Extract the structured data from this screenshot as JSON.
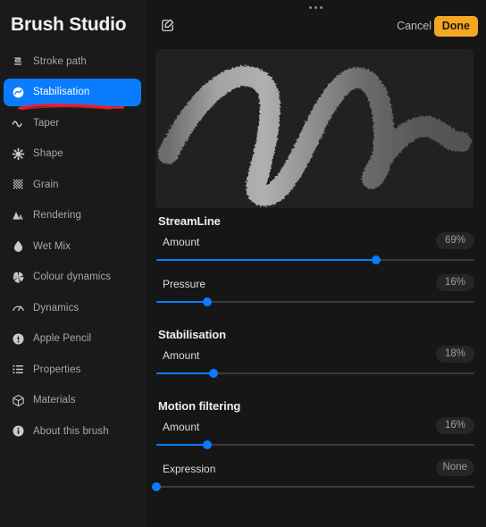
{
  "app": {
    "title": "Brush Studio"
  },
  "sidebar": {
    "items": [
      {
        "label": "Stroke path",
        "icon": "stroke-path-icon",
        "active": false
      },
      {
        "label": "Stabilisation",
        "icon": "stabilisation-icon",
        "active": true
      },
      {
        "label": "Taper",
        "icon": "taper-icon",
        "active": false
      },
      {
        "label": "Shape",
        "icon": "shape-icon",
        "active": false
      },
      {
        "label": "Grain",
        "icon": "grain-icon",
        "active": false
      },
      {
        "label": "Rendering",
        "icon": "rendering-icon",
        "active": false
      },
      {
        "label": "Wet Mix",
        "icon": "wet-mix-icon",
        "active": false
      },
      {
        "label": "Colour dynamics",
        "icon": "colour-dynamics-icon",
        "active": false
      },
      {
        "label": "Dynamics",
        "icon": "dynamics-icon",
        "active": false
      },
      {
        "label": "Apple Pencil",
        "icon": "apple-pencil-icon",
        "active": false
      },
      {
        "label": "Properties",
        "icon": "properties-icon",
        "active": false
      },
      {
        "label": "Materials",
        "icon": "materials-icon",
        "active": false
      },
      {
        "label": "About this brush",
        "icon": "info-icon",
        "active": false
      }
    ]
  },
  "topbar": {
    "edit_icon": "edit-square-pencil-icon",
    "cancel_label": "Cancel",
    "done_label": "Done",
    "grabber_icon": "three-dots-handle-icon"
  },
  "preview": {
    "name": "brush-stroke-preview"
  },
  "sections": [
    {
      "title": "StreamLine",
      "rows": [
        {
          "label": "Amount",
          "value": "69%",
          "percent": 69
        },
        {
          "label": "Pressure",
          "value": "16%",
          "percent": 16
        }
      ]
    },
    {
      "title": "Stabilisation",
      "rows": [
        {
          "label": "Amount",
          "value": "18%",
          "percent": 18
        }
      ]
    },
    {
      "title": "Motion filtering",
      "rows": [
        {
          "label": "Amount",
          "value": "16%",
          "percent": 16
        },
        {
          "label": "Expression",
          "value": "None",
          "percent": 0
        }
      ]
    }
  ],
  "colors": {
    "accent_blue": "#0a7cff",
    "done_amber": "#f5a623",
    "annotation_red": "#ee1f2a",
    "sidebar_bg": "#1a1a1a",
    "main_bg": "#161616"
  }
}
